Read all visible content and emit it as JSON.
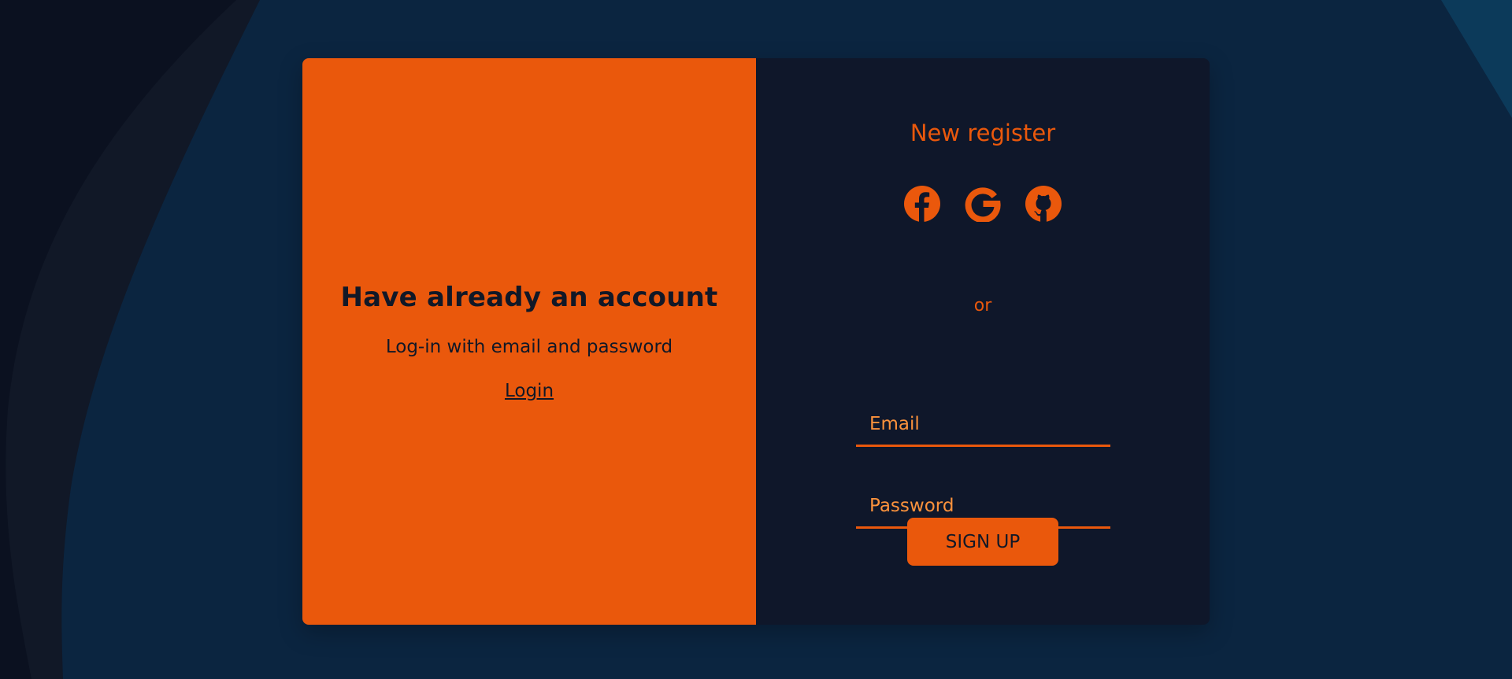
{
  "colors": {
    "accent": "#ea580c",
    "panel_dark": "#0f172a",
    "background": "#0b2540",
    "input_text": "#fb923c"
  },
  "left_panel": {
    "title": "Have already an account",
    "subtitle": "Log-in with email and password",
    "login_link": "Login"
  },
  "right_panel": {
    "title": "New register",
    "social_icons": [
      "facebook-icon",
      "google-icon",
      "github-icon"
    ],
    "separator": "or",
    "email_placeholder": "Email",
    "password_placeholder": "Password",
    "signup_label": "SIGN UP"
  }
}
